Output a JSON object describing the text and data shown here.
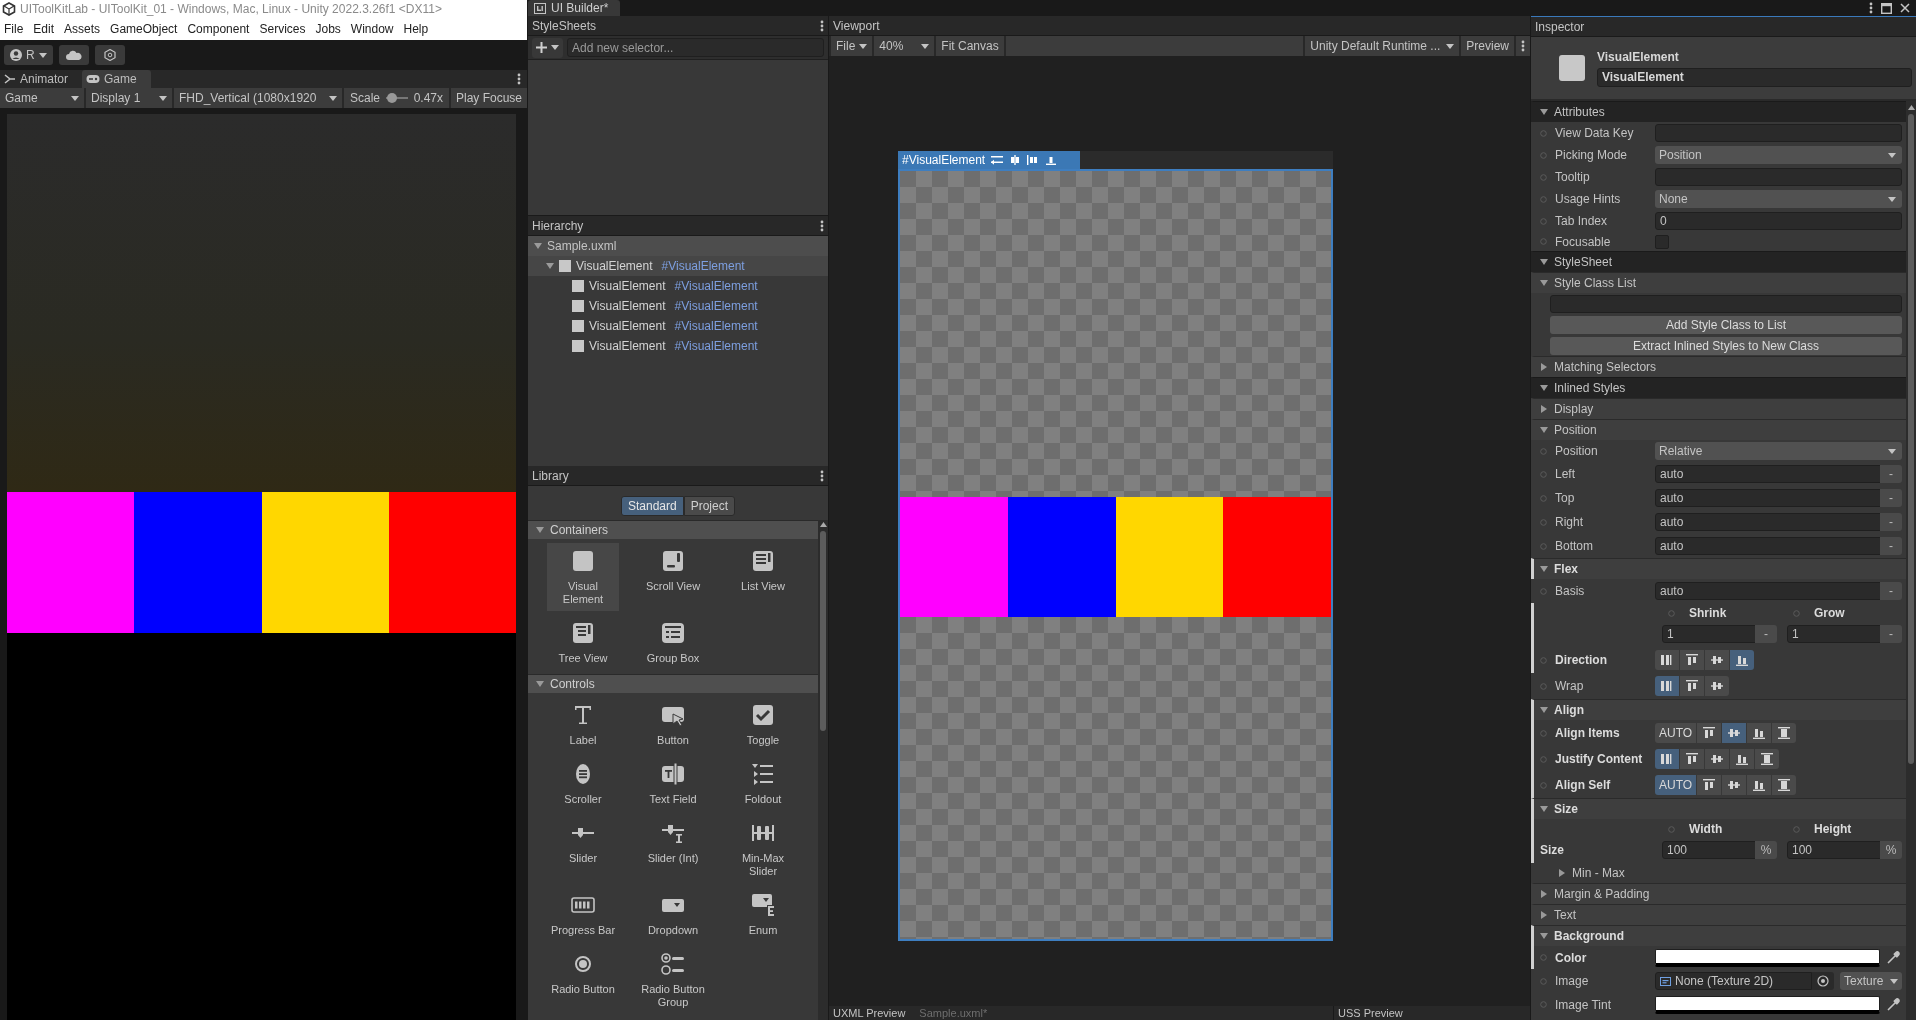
{
  "window": {
    "title": "UIToolKitLab - UIToolKit_01 - Windows, Mac, Linux - Unity 2022.3.26f1 <DX11>"
  },
  "menu": [
    "File",
    "Edit",
    "Assets",
    "GameObject",
    "Component",
    "Services",
    "Jobs",
    "Window",
    "Help"
  ],
  "toolbar": {
    "account": "R"
  },
  "game": {
    "tabs": [
      {
        "label": "Animator",
        "selected": false
      },
      {
        "label": "Game",
        "selected": true
      }
    ],
    "view_mode": "Game",
    "display": "Display 1",
    "resolution": "FHD_Vertical (1080x1920",
    "scale_label": "Scale",
    "scale": {
      "level": 0.05
    },
    "scale_reading": "0.47x",
    "play_mode": "Play Focuse",
    "blocks": [
      {
        "color": "#ff00ff"
      },
      {
        "color": "#0000ff"
      },
      {
        "color": "#ffd700"
      },
      {
        "color": "#ff0000"
      }
    ]
  },
  "builder": {
    "tab": "UI Builder*",
    "stylesheets": {
      "title": "StyleSheets",
      "placeholder": "Add new selector..."
    },
    "hierarchy": {
      "title": "Hierarchy",
      "items": [
        {
          "name": "Sample.uxml",
          "expanded": true,
          "children": [
            {
              "type": "VisualElement",
              "selector": "#VisualElement",
              "expanded": true,
              "selected": true,
              "children": [
                {
                  "type": "VisualElement",
                  "selector": "#VisualElement",
                  "selected": false
                },
                {
                  "type": "VisualElement",
                  "selector": "#VisualElement",
                  "selected": false
                },
                {
                  "type": "VisualElement",
                  "selector": "#VisualElement",
                  "selected": false
                },
                {
                  "type": "VisualElement",
                  "selector": "#VisualElement",
                  "selected": false
                }
              ]
            }
          ]
        }
      ]
    },
    "library": {
      "title": "Library",
      "tabs": [
        {
          "label": "Standard",
          "selected": true
        },
        {
          "label": "Project",
          "selected": false
        }
      ],
      "sections": [
        {
          "title": "Containers",
          "expanded": true,
          "items": [
            {
              "label": "Visual Element",
              "selected": true
            },
            {
              "label": "Scroll View",
              "selected": false
            },
            {
              "label": "List View",
              "selected": false
            },
            {
              "label": "Tree View",
              "selected": false
            },
            {
              "label": "Group Box",
              "selected": false
            }
          ]
        },
        {
          "title": "Controls",
          "expanded": true,
          "items": [
            {
              "label": "Label",
              "selected": false
            },
            {
              "label": "Button",
              "selected": false
            },
            {
              "label": "Toggle",
              "selected": false
            },
            {
              "label": "Scroller",
              "selected": false
            },
            {
              "label": "Text Field",
              "selected": false
            },
            {
              "label": "Foldout",
              "selected": false
            },
            {
              "label": "Slider",
              "selected": false
            },
            {
              "label": "Slider (Int)",
              "selected": false
            },
            {
              "label": "Min-Max Slider",
              "selected": false
            },
            {
              "label": "Progress Bar",
              "selected": false
            },
            {
              "label": "Dropdown",
              "selected": false
            },
            {
              "label": "Enum",
              "selected": false
            },
            {
              "label": "Radio Button",
              "selected": false
            },
            {
              "label": "Radio Button Group",
              "selected": false
            }
          ]
        }
      ]
    }
  },
  "viewport": {
    "title": "Viewport",
    "file": "File",
    "zoom": "40%",
    "fit": "Fit Canvas",
    "theme": "Unity Default Runtime ...",
    "preview": "Preview",
    "canvas": {
      "label": "#VisualElement",
      "blocks": [
        {
          "color": "#ff00ff"
        },
        {
          "color": "#0000ff"
        },
        {
          "color": "#ffd700"
        },
        {
          "color": "#ff0000"
        }
      ]
    },
    "bottom": {
      "uxml": "UXML Preview",
      "file": "Sample.uxml*",
      "uss": "USS Preview"
    }
  },
  "inspector": {
    "title": "Inspector",
    "element_type": "VisualElement",
    "element_name": "VisualElement",
    "rows": [
      {
        "kind": "header",
        "title": "Attributes",
        "expanded": true,
        "overridden": false
      },
      {
        "kind": "text",
        "label": "View Data Key",
        "overridden": false
      },
      {
        "kind": "dropdown",
        "label": "Picking Mode",
        "value": "Position",
        "overridden": false
      },
      {
        "kind": "text",
        "label": "Tooltip",
        "overridden": false
      },
      {
        "kind": "dropdown",
        "label": "Usage Hints",
        "value": "None",
        "overridden": false
      },
      {
        "kind": "text",
        "label": "Tab Index",
        "value": "0",
        "overridden": false
      },
      {
        "kind": "checkbox",
        "label": "Focusable",
        "checked": false,
        "overridden": false
      },
      {
        "kind": "header",
        "title": "StyleSheet",
        "expanded": true,
        "overridden": false
      },
      {
        "kind": "group",
        "title": "Style Class List",
        "expanded": true,
        "overridden": false
      },
      {
        "kind": "input",
        "overridden": false
      },
      {
        "kind": "button",
        "label": "Add Style Class to List",
        "overridden": false
      },
      {
        "kind": "button",
        "label": "Extract Inlined Styles to New Class",
        "overridden": false
      },
      {
        "kind": "group",
        "title": "Matching Selectors",
        "expanded": false,
        "overridden": false
      },
      {
        "kind": "header",
        "title": "Inlined Styles",
        "expanded": true,
        "overridden": false
      },
      {
        "kind": "group",
        "title": "Display",
        "expanded": false,
        "overridden": false
      },
      {
        "kind": "group",
        "title": "Position",
        "expanded": true,
        "overridden": false
      },
      {
        "kind": "dropdown",
        "label": "Position",
        "value": "Relative",
        "overridden": false
      },
      {
        "kind": "length",
        "label": "Left",
        "value": "auto",
        "unit": "-",
        "overridden": false
      },
      {
        "kind": "length",
        "label": "Top",
        "value": "auto",
        "unit": "-",
        "overridden": false
      },
      {
        "kind": "length",
        "label": "Right",
        "value": "auto",
        "unit": "-",
        "overridden": false
      },
      {
        "kind": "length",
        "label": "Bottom",
        "value": "auto",
        "unit": "-",
        "overridden": false
      },
      {
        "kind": "group",
        "title": "Flex",
        "expanded": true,
        "overridden": true
      },
      {
        "kind": "length",
        "label": "Basis",
        "value": "auto",
        "unit": "-",
        "overridden": false
      },
      {
        "kind": "pair",
        "overridden": true,
        "fields": [
          {
            "label": "Shrink",
            "value": "1",
            "unit": "-"
          },
          {
            "label": "Grow",
            "value": "1",
            "unit": "-"
          }
        ]
      },
      {
        "kind": "toggles",
        "label": "Direction",
        "overridden": true,
        "highlighted": false,
        "options": [
          {
            "selected": false
          },
          {
            "selected": false
          },
          {
            "selected": false
          },
          {
            "selected": true
          }
        ]
      },
      {
        "kind": "toggles",
        "label": "Wrap",
        "overridden": false,
        "highlighted": false,
        "options": [
          {
            "selected": true
          },
          {
            "selected": false
          },
          {
            "selected": false
          }
        ]
      },
      {
        "kind": "group",
        "title": "Align",
        "expanded": true,
        "overridden": true
      },
      {
        "kind": "toggles",
        "label": "Align Items",
        "overridden": true,
        "highlighted": true,
        "options": [
          {
            "text": "AUTO",
            "selected": false
          },
          {
            "selected": false
          },
          {
            "selected": true
          },
          {
            "selected": false
          },
          {
            "selected": false
          }
        ]
      },
      {
        "kind": "toggles",
        "label": "Justify Content",
        "overridden": true,
        "highlighted": false,
        "options": [
          {
            "selected": true
          },
          {
            "selected": false
          },
          {
            "selected": false
          },
          {
            "selected": false
          },
          {
            "selected": false
          }
        ]
      },
      {
        "kind": "toggles",
        "label": "Align Self",
        "overridden": true,
        "highlighted": false,
        "options": [
          {
            "text": "AUTO",
            "selected": true
          },
          {
            "selected": false
          },
          {
            "selected": false
          },
          {
            "selected": false
          },
          {
            "selected": false
          }
        ]
      },
      {
        "kind": "group",
        "title": "Size",
        "expanded": true,
        "overridden": true
      },
      {
        "kind": "pair",
        "label": "Size",
        "overridden": true,
        "fields": [
          {
            "label": "Width",
            "value": "100",
            "unit": "%"
          },
          {
            "label": "Height",
            "value": "100",
            "unit": "%"
          }
        ]
      },
      {
        "kind": "foldout",
        "title": "Min - Max",
        "expanded": false,
        "overridden": false
      },
      {
        "kind": "group",
        "title": "Margin & Padding",
        "expanded": false,
        "overridden": false
      },
      {
        "kind": "group",
        "title": "Text",
        "expanded": false,
        "overridden": false
      },
      {
        "kind": "group",
        "title": "Background",
        "expanded": true,
        "overridden": true
      },
      {
        "kind": "color",
        "label": "Color",
        "color": "#ffffff",
        "overridden": true
      },
      {
        "kind": "object",
        "label": "Image",
        "value": "None (Texture 2D)",
        "mode": "Texture",
        "overridden": false
      },
      {
        "kind": "color",
        "label": "Image Tint",
        "color": "#ffffff",
        "overridden": false
      }
    ]
  }
}
